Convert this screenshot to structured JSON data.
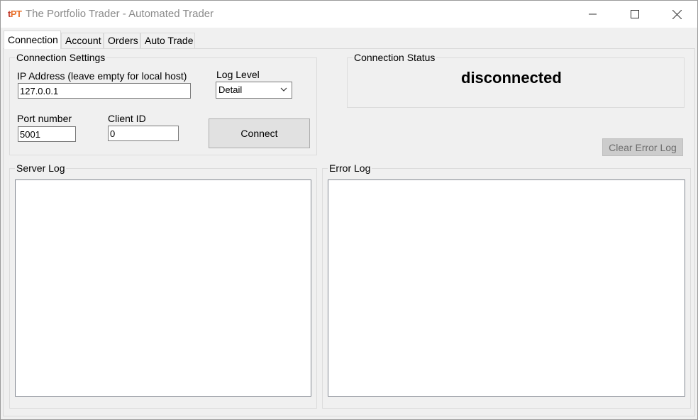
{
  "window": {
    "logo_t": "t",
    "logo_pt": "PT",
    "title": "The Portfolio Trader - Automated Trader",
    "colors": {
      "logo_t": "#c0392b",
      "logo_pt": "#e8702a",
      "title_text": "#8a8a8a"
    }
  },
  "tabs": [
    {
      "label": "Connection",
      "active": true
    },
    {
      "label": "Account",
      "active": false
    },
    {
      "label": "Orders",
      "active": false
    },
    {
      "label": "Auto Trade",
      "active": false
    }
  ],
  "connection_settings": {
    "title": "Connection Settings",
    "ip_label": "IP Address (leave empty for local host)",
    "ip_value": "127.0.0.1",
    "log_level_label": "Log Level",
    "log_level_value": "Detail",
    "port_label": "Port number",
    "port_value": "5001",
    "client_id_label": "Client ID",
    "client_id_value": "0",
    "connect_label": "Connect"
  },
  "connection_status": {
    "title": "Connection Status",
    "status": "disconnected"
  },
  "clear_error_log_label": "Clear Error Log",
  "server_log": {
    "title": "Server Log",
    "content": ""
  },
  "error_log": {
    "title": "Error Log",
    "content": ""
  }
}
